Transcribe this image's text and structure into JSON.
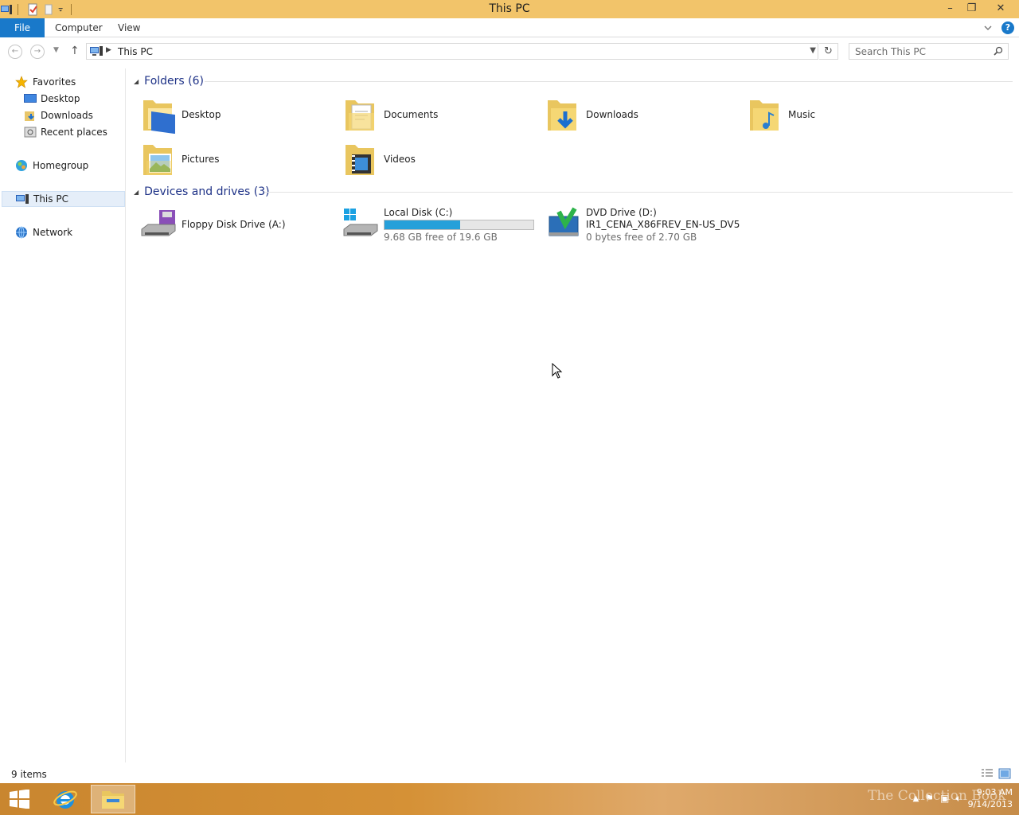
{
  "window": {
    "title": "This PC",
    "controls": {
      "minimize": "–",
      "restore": "❐",
      "close": "✕"
    }
  },
  "ribbon": {
    "tabs": [
      {
        "label": "File",
        "active": true
      },
      {
        "label": "Computer"
      },
      {
        "label": "View"
      }
    ],
    "help_label": "?"
  },
  "address": {
    "path": "This PC",
    "search_placeholder": "Search This PC"
  },
  "nav_pane": {
    "favorites": "Favorites",
    "favorite_items": [
      "Desktop",
      "Downloads",
      "Recent places"
    ],
    "homegroup": "Homegroup",
    "this_pc": "This PC",
    "network": "Network"
  },
  "content": {
    "folders_header": "Folders (6)",
    "folders": [
      "Desktop",
      "Documents",
      "Downloads",
      "Music",
      "Pictures",
      "Videos"
    ],
    "devices_header": "Devices and drives (3)",
    "floppy": {
      "name": "Floppy Disk Drive (A:)"
    },
    "local_disk": {
      "name": "Local Disk (C:)",
      "free": "9.68 GB free of 19.6 GB",
      "used_fraction": 0.506
    },
    "dvd": {
      "name": "DVD Drive (D:)",
      "label": "IR1_CENA_X86FREV_EN-US_DV5",
      "free": "0 bytes free of 2.70 GB"
    }
  },
  "status": {
    "items": "9 items"
  },
  "taskbar": {
    "time": "9:03 AM",
    "date": "9/14/2013",
    "watermark": "The Collection Book"
  },
  "colors": {
    "titlebar": "#f2c46a",
    "accent": "#1979ca",
    "disk_bar": "#26a0da",
    "group_header": "#1e3287"
  }
}
